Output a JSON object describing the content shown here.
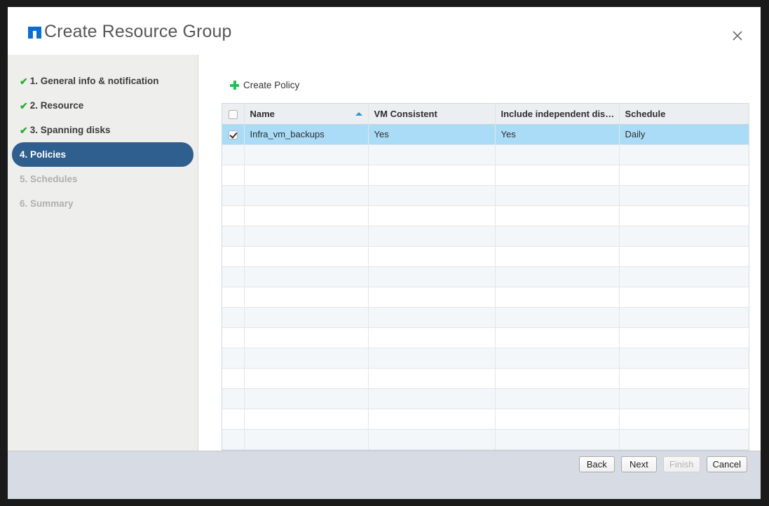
{
  "window": {
    "title": "Create Resource Group",
    "logo_icon": "nutanix-logo-icon",
    "close_icon": "close-icon"
  },
  "sidebar": {
    "steps": [
      {
        "label": "1. General info & notification",
        "state": "complete",
        "check": "✔"
      },
      {
        "label": "2. Resource",
        "state": "complete",
        "check": "✔"
      },
      {
        "label": "3. Spanning disks",
        "state": "complete",
        "check": "✔"
      },
      {
        "label": "4. Policies",
        "state": "active",
        "check": ""
      },
      {
        "label": "5. Schedules",
        "state": "disabled",
        "check": ""
      },
      {
        "label": "6. Summary",
        "state": "disabled",
        "check": ""
      }
    ]
  },
  "main": {
    "create_policy_label": "Create Policy",
    "create_policy_icon": "plus-icon",
    "table": {
      "columns": [
        {
          "key": "name",
          "label": "Name",
          "sorted": true,
          "sort_direction": "asc"
        },
        {
          "key": "vm_consistent",
          "label": "VM Consistent",
          "sorted": false
        },
        {
          "key": "include_independent_disks",
          "label": "Include independent dis…",
          "sorted": false
        },
        {
          "key": "schedule",
          "label": "Schedule",
          "sorted": false
        }
      ],
      "header_checkbox_checked": false,
      "rows": [
        {
          "selected": true,
          "checked": true,
          "name": "Infra_vm_backups",
          "vm_consistent": "Yes",
          "include_independent_disks": "Yes",
          "schedule": "Daily"
        }
      ],
      "empty_row_count": 15
    }
  },
  "footer": {
    "buttons": [
      {
        "label": "Back",
        "disabled": false
      },
      {
        "label": "Next",
        "disabled": false
      },
      {
        "label": "Finish",
        "disabled": true
      },
      {
        "label": "Cancel",
        "disabled": false
      }
    ]
  },
  "colors": {
    "accent_blue": "#0a6ed1",
    "active_step": "#2e5f8f",
    "check_green": "#23b02c",
    "plus_green": "#22c05a",
    "selected_row": "#aadcf8",
    "sort_arrow": "#2e93d1",
    "footer_bg": "#d7dce4",
    "sidebar_bg": "#eeeeec"
  }
}
